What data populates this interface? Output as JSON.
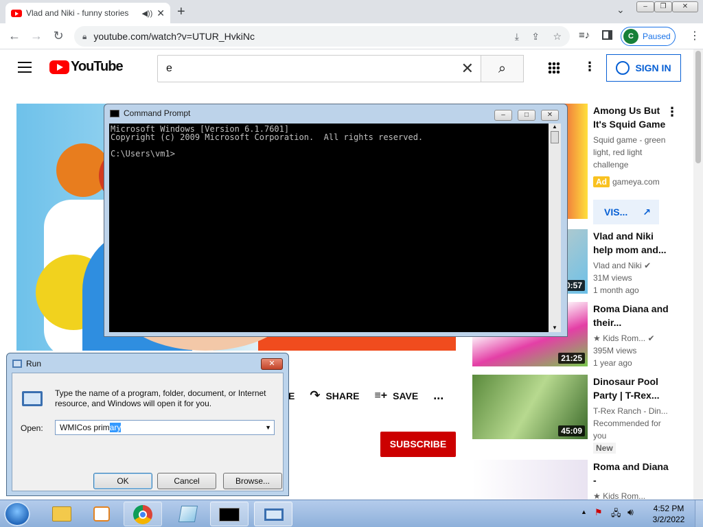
{
  "browser": {
    "tab_title": "Vlad and Niki - funny stories",
    "new_tab": "+",
    "url": "youtube.com/watch?v=UTUR_HvkiNc",
    "profile_initial": "C",
    "profile_status": "Paused"
  },
  "youtube": {
    "logo": "YouTube",
    "search_value": "e",
    "sign_in": "SIGN IN",
    "actions": {
      "share": "SHARE",
      "save": "SAVE",
      "partial": "E",
      "more": "..."
    },
    "subscribe": "SUBSCRIBE"
  },
  "sidebar": [
    {
      "title": "Among Us But It's Squid Game",
      "meta1": "Squid game - green light, red light challenge",
      "ad_badge": "Ad",
      "ad_domain": "gameya.com",
      "visit": "VIS..."
    },
    {
      "title": "Vlad and Niki help mom and...",
      "channel": "Vlad and Niki",
      "views": "31M views",
      "age": "1 month ago",
      "duration": "0:57"
    },
    {
      "title": "Roma Diana and their...",
      "channel": "★ Kids Rom...",
      "views": "395M views",
      "age": "1 year ago",
      "duration": "21:25"
    },
    {
      "title": "Dinosaur Pool Party | T-Rex...",
      "channel": "T-Rex Ranch - Din...",
      "rec": "Recommended for you",
      "badge": "New",
      "duration": "45:09"
    },
    {
      "title": "Roma and Diana -",
      "channel": "★ Kids Rom..."
    }
  ],
  "cmd": {
    "title": "Command Prompt",
    "lines": "Microsoft Windows [Version 6.1.7601]\nCopyright (c) 2009 Microsoft Corporation.  All rights reserved.\n\nC:\\Users\\vm1>"
  },
  "run": {
    "title": "Run",
    "description": "Type the name of a program, folder, document, or Internet resource, and Windows will open it for you.",
    "open_label": "Open:",
    "input_value_plain": "WMICos prim",
    "input_value_selected": "ary",
    "ok": "OK",
    "cancel": "Cancel",
    "browse": "Browse..."
  },
  "taskbar": {
    "time": "4:52 PM",
    "date": "3/2/2022"
  },
  "colors": {
    "yt_red": "#ff0000",
    "subscribe_red": "#cc0000",
    "link_blue": "#065fd4",
    "cmd_bg": "#000000"
  }
}
